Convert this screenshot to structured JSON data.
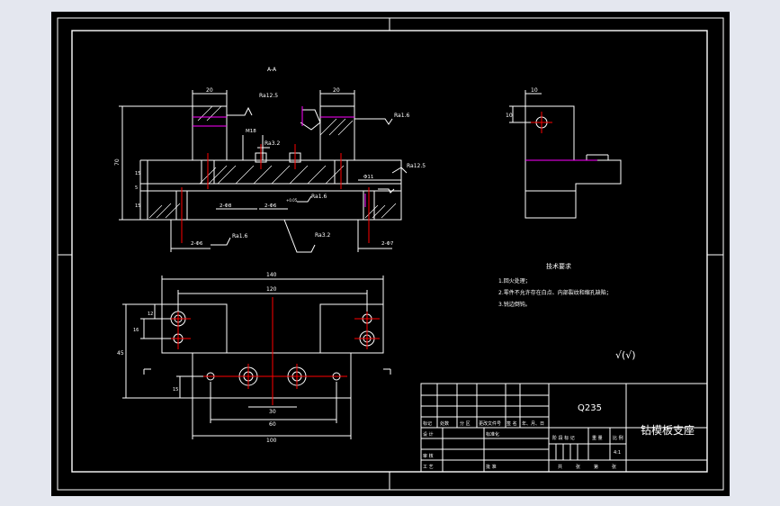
{
  "sheet": {
    "section_label": "A-A",
    "part_name": "钻模板支座",
    "material": "Q235",
    "scale": "4:1",
    "surface_symbol": "√(√)"
  },
  "tech_requirements": {
    "title": "技术要求",
    "items": [
      "1.回火处理；",
      "2.零件不允许存在白点、内部裂纹和缩孔缺陷；",
      "3.锐边倒钝。"
    ]
  },
  "dimensions": {
    "top_left_width": "20",
    "top_right_width": "20",
    "height_total": "70",
    "h_15": "15",
    "h_5": "5",
    "h_15b": "15",
    "m_size": "M18",
    "hole_2phi8": "2-Φ8",
    "hole_2phi6": "2-Φ6",
    "hole_2phi6b": "2-Φ6",
    "hole_2phi7": "2-Φ7",
    "phi11": "Φ11",
    "plan_140": "140",
    "plan_120": "120",
    "plan_30": "30",
    "plan_60": "60",
    "plan_100": "100",
    "plan_h45": "45",
    "plan_h16": "16",
    "plan_h12": "12",
    "plan_h15": "15",
    "side_10a": "10",
    "side_10b": "10",
    "tol_top": "+0.05",
    "tol_bot": "0"
  },
  "roughness": {
    "r1": "Ra12.5",
    "r2": "Ra1.6",
    "r3": "Ra3.2",
    "r4": "Ra12.5",
    "r5": "Ra1.6",
    "r6": "Ra1.6",
    "r7": "Ra3.2"
  },
  "title_block": {
    "mark": "标记",
    "count": "处数",
    "zone": "分 区",
    "doc_no": "更改文件号",
    "sign": "签 名",
    "date": "年、月、日",
    "design": "设 计",
    "standardize": "标准化",
    "stage_mark": "阶 段 标 记",
    "weight": "重 量",
    "ratio": "比 例",
    "review": "审 核",
    "craft": "工 艺",
    "approve": "批 准",
    "sheet_total": "共",
    "sheet_no": "张",
    "sheet_of": "第",
    "sheet_no2": "张"
  },
  "colors": {
    "background": "#000000",
    "line": "#ffffff",
    "center": "#ff0000",
    "accent": "#ff00ff",
    "outer": "#e4e7ef"
  }
}
